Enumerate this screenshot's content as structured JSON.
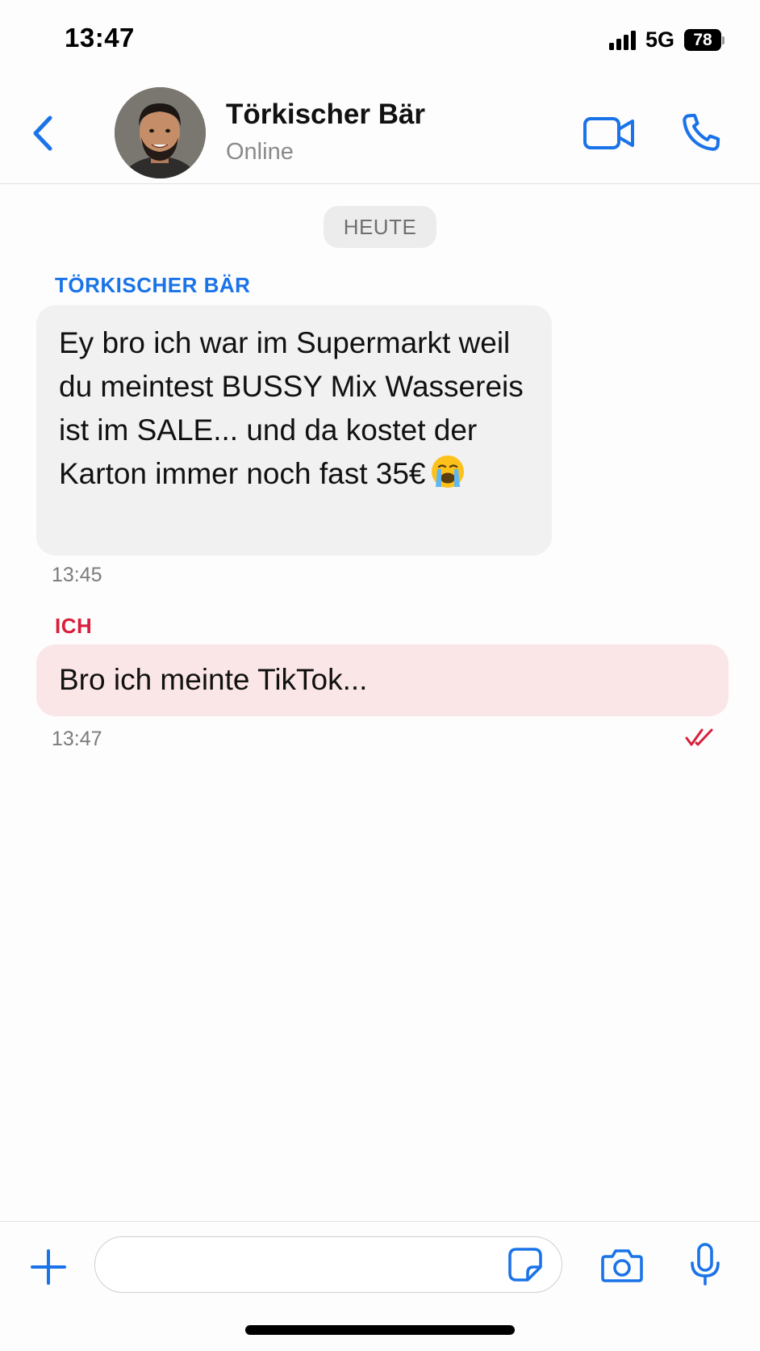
{
  "status_bar": {
    "time": "13:47",
    "network": "5G",
    "battery": "78"
  },
  "header": {
    "contact_name": "Törkischer Bär",
    "contact_status": "Online",
    "icons": [
      "chevron-left-icon",
      "video-camera-icon",
      "phone-icon"
    ]
  },
  "chat": {
    "date_separator": "HEUTE",
    "messages": [
      {
        "sender": "TÖRKISCHER BÄR",
        "text": "Ey bro ich war im Supermarkt weil du meintest BUSSY Mix Wassereis ist im SALE... und da kostet der Karton immer noch fast 35€",
        "emoji": "😭",
        "time": "13:45"
      },
      {
        "sender": "ICH",
        "text": "Bro ich meinte TikTok...",
        "time": "13:47",
        "status_icon": "double-check-icon"
      }
    ]
  },
  "input_bar": {
    "placeholder": "",
    "icons": [
      "plus-icon",
      "sticker-icon",
      "camera-icon",
      "microphone-icon"
    ]
  },
  "colors": {
    "accent_blue": "#1a73e8",
    "accent_red": "#d91e3a",
    "incoming_bubble": "#f1f1f1",
    "outgoing_bubble": "#fbe6e7"
  }
}
